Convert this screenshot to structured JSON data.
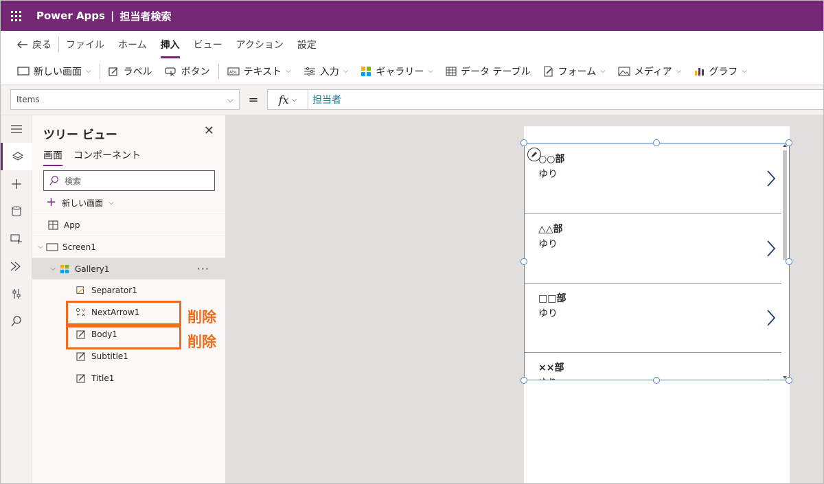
{
  "titlebar": {
    "app_name": "Power Apps",
    "separator": "|",
    "doc_title": "担当者検索",
    "color": "#742774"
  },
  "menubar": {
    "back": "戻る",
    "items": [
      "ファイル",
      "ホーム",
      "挿入",
      "ビュー",
      "アクション",
      "設定"
    ],
    "active": "挿入"
  },
  "ribbon": {
    "new_screen": "新しい画面",
    "label": "ラベル",
    "button": "ボタン",
    "text": "テキスト",
    "input": "入力",
    "gallery": "ギャラリー",
    "data_table": "データ テーブル",
    "form": "フォーム",
    "media": "メディア",
    "chart": "グラフ"
  },
  "formula": {
    "property": "Items",
    "equals": "=",
    "fx": "fx",
    "value": "担当者"
  },
  "tree": {
    "title": "ツリー ビュー",
    "tabs": [
      "画面",
      "コンポーネント"
    ],
    "search_placeholder": "検索",
    "new_screen": "新しい画面",
    "rows": {
      "app": "App",
      "screen": "Screen1",
      "gallery": "Gallery1",
      "separator": "Separator1",
      "next_arrow": "NextArrow1",
      "body": "Body1",
      "subtitle": "Subtitle1",
      "title": "Title1"
    },
    "more": "···"
  },
  "annotations": {
    "delete_label_1": "削除",
    "delete_label_2": "削除",
    "color": "#ed6d1f"
  },
  "gallery": {
    "items": [
      {
        "title": "○○部",
        "subtitle": "ゆり"
      },
      {
        "title": "△△部",
        "subtitle": "ゆり"
      },
      {
        "title": "□□部",
        "subtitle": "ゆり"
      },
      {
        "title": "××部",
        "subtitle": "ゆり"
      }
    ]
  }
}
